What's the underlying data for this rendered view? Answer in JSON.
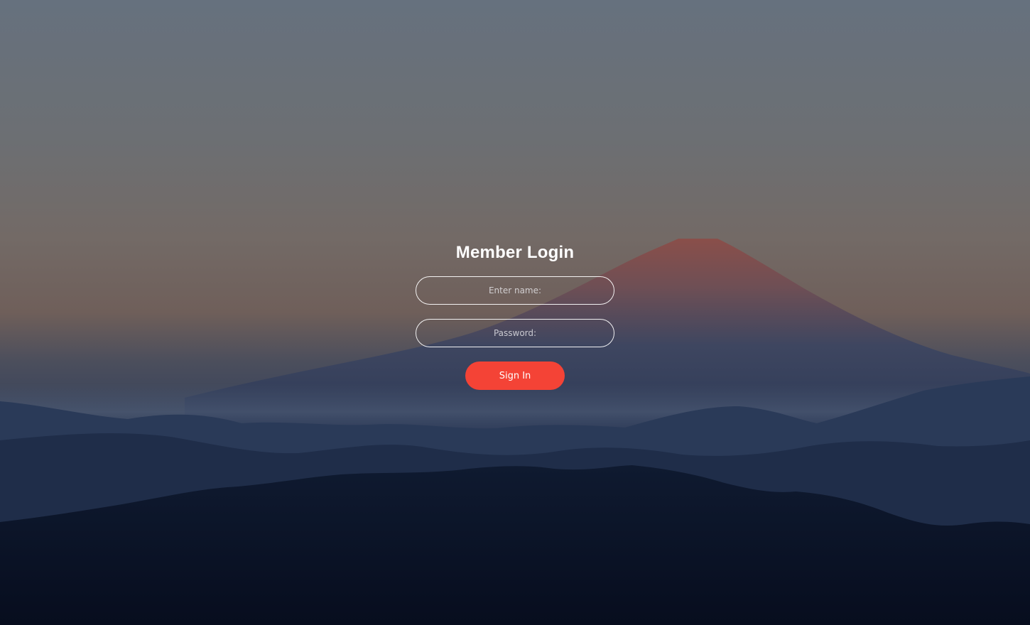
{
  "login": {
    "title": "Member Login",
    "name_placeholder": "Enter name:",
    "password_placeholder": "Password:",
    "signin_label": "Sign In"
  },
  "colors": {
    "accent": "#f44336",
    "text": "#ffffff",
    "sky_top": "#66717e",
    "sky_horizon": "#755f58",
    "foreground": "#0b1224"
  },
  "background": {
    "subject": "mountain-landscape"
  }
}
